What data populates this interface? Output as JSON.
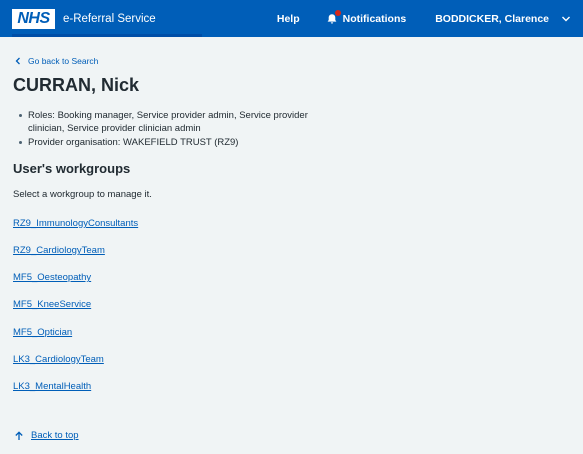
{
  "header": {
    "logo_text": "NHS",
    "service_name": "e-Referral Service",
    "help_label": "Help",
    "notifications_label": "Notifications",
    "user_name": "BODDICKER, Clarence",
    "brand_color": "#005eb8",
    "badge_color": "#d5281b"
  },
  "back_link": {
    "icon": "chevron-left-icon",
    "label": "Go back to Search"
  },
  "page_title": "CURRAN, Nick",
  "details": [
    "Roles: Booking manager, Service provider admin, Service provider clinician, Service provider clinician admin",
    "Provider organisation: WAKEFIELD TRUST (RZ9)"
  ],
  "workgroups": {
    "heading": "User's workgroups",
    "intro": "Select a workgroup to manage it.",
    "items": [
      "RZ9_ImmunologyConsultants",
      "RZ9_CardiologyTeam",
      "MF5_Oesteopathy",
      "MF5_KneeService",
      "MF5_Optician",
      "LK3_CardiologyTeam",
      "LK3_MentalHealth"
    ]
  },
  "back_to_top": {
    "icon": "arrow-up-icon",
    "label": "Back to top"
  }
}
